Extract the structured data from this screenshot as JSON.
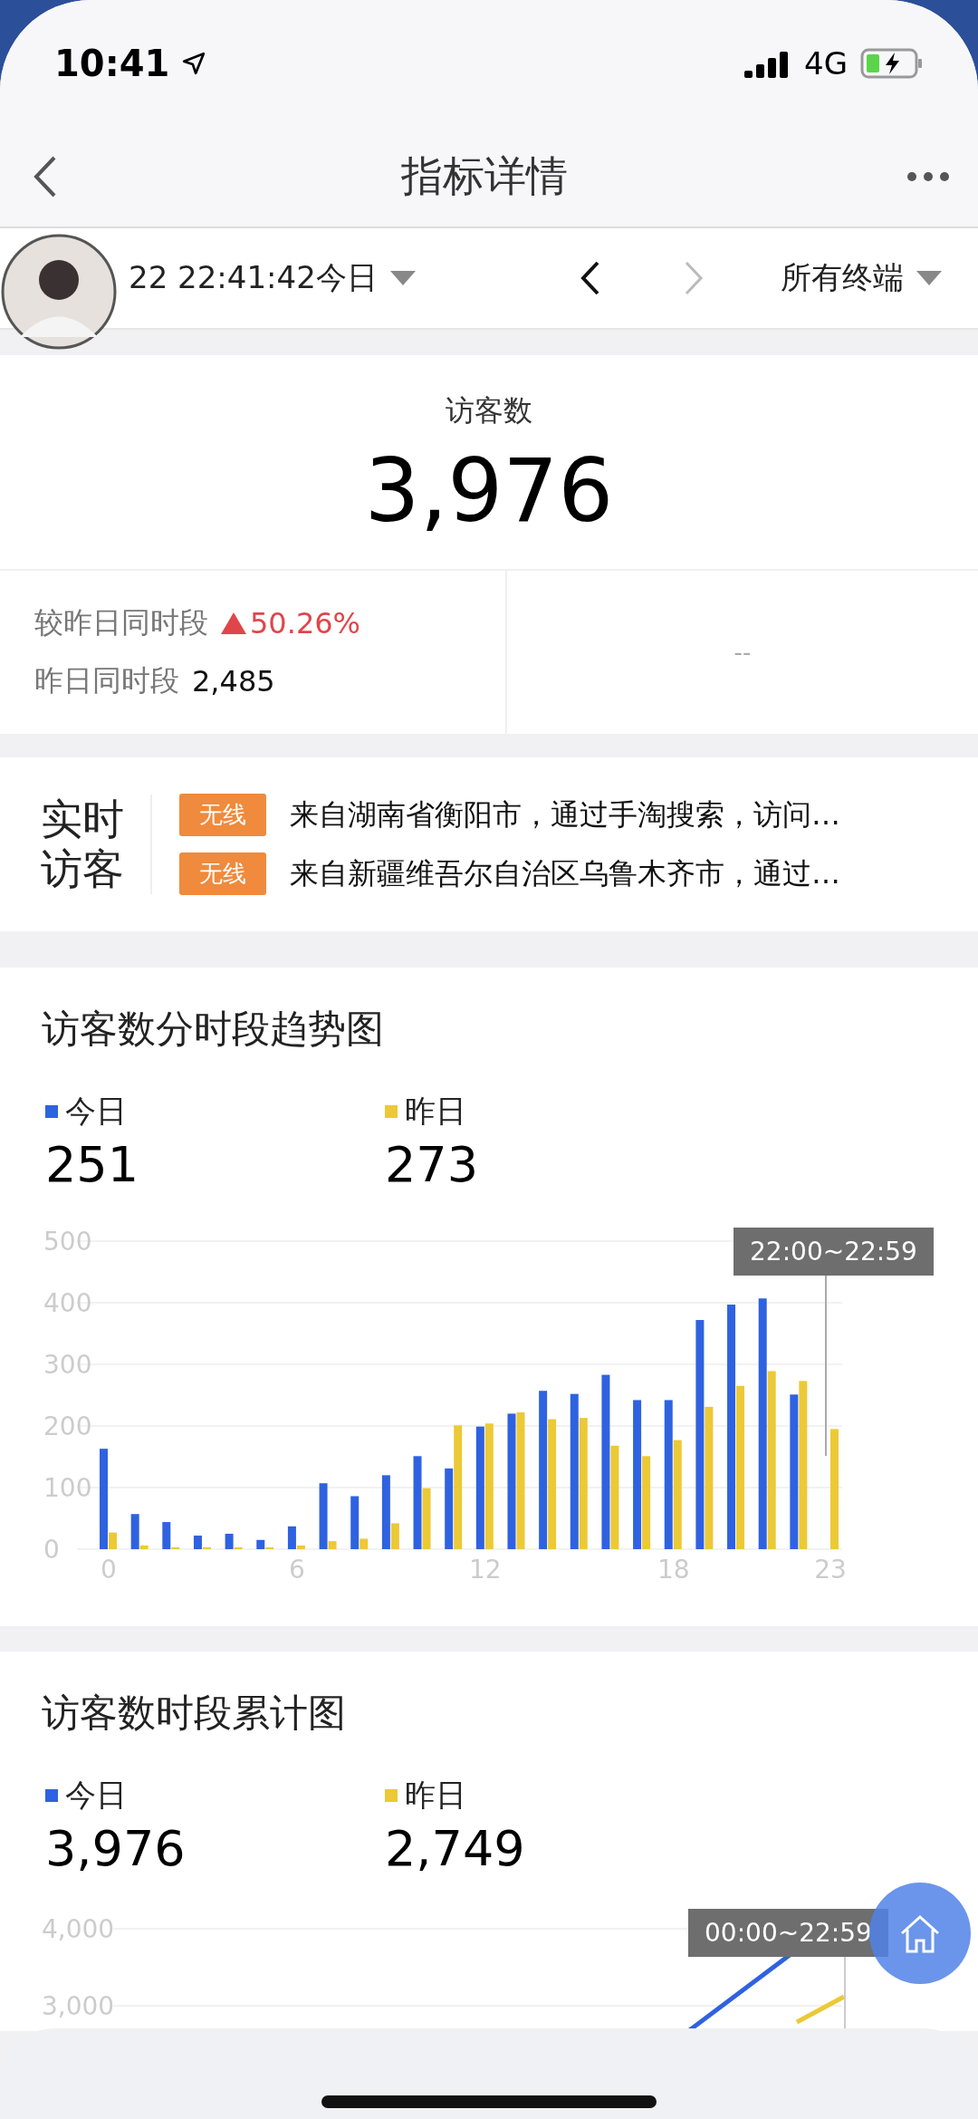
{
  "status_bar": {
    "time": "10:41",
    "network": "4G"
  },
  "nav": {
    "title": "指标详情"
  },
  "filter": {
    "date": "22 22:41:42今日",
    "terminal": "所有终端"
  },
  "metric": {
    "label": "访客数",
    "value": "3,976",
    "compare_label": "较昨日同时段",
    "compare_value": "50.26%",
    "yesterday_label": "昨日同时段",
    "yesterday_value": "2,485",
    "right_value": "--"
  },
  "realtime": {
    "title": "实时访客",
    "items": [
      {
        "tag": "无线",
        "text": "来自湖南省衡阳市，通过手淘搜索，访问…"
      },
      {
        "tag": "无线",
        "text": "来自新疆维吾尔自治区乌鲁木齐市，通过…"
      }
    ]
  },
  "charts": [
    {
      "title": "访客数分时段趋势图",
      "legend": [
        {
          "value": "251"
        },
        {
          "value": "273"
        }
      ],
      "tooltip": "22:00~22:59",
      "chart_data": {
        "type": "bar",
        "x": [
          0,
          1,
          2,
          3,
          4,
          5,
          6,
          7,
          8,
          9,
          10,
          11,
          12,
          13,
          14,
          15,
          16,
          17,
          18,
          19,
          20,
          21,
          22,
          23
        ],
        "xlim": [
          0,
          23
        ],
        "grid": true,
        "ylim": [
          0,
          500
        ],
        "yticks": [
          0,
          100,
          200,
          300,
          400,
          500
        ],
        "xticks": [
          0,
          6,
          12,
          18,
          23
        ],
        "series": [
          {
            "name": "今日",
            "color": "#2f62e0",
            "values": [
              163,
              57,
              44,
              22,
              25,
              15,
              37,
              107,
              86,
              120,
              151,
              131,
              199,
              220,
              257,
              252,
              283,
              242,
              242,
              372,
              397,
              407,
              251,
              null
            ]
          },
          {
            "name": "昨日",
            "color": "#ecc936",
            "values": [
              27,
              6,
              3,
              3,
              3,
              3,
              6,
              13,
              17,
              42,
              99,
              201,
              204,
              222,
              211,
              213,
              168,
              151,
              177,
              231,
              265,
              289,
              273,
              195
            ]
          }
        ]
      }
    },
    {
      "title": "访客数时段累计图",
      "legend": [
        {
          "name": "今日",
          "color": "#2f62e0",
          "value": "3,976"
        },
        {
          "name": "昨日",
          "color": "#ecc936",
          "value": "2,749"
        }
      ],
      "tooltip": "00:00~22:59",
      "axis_labels": [
        "4,000",
        "3,000"
      ]
    }
  ]
}
